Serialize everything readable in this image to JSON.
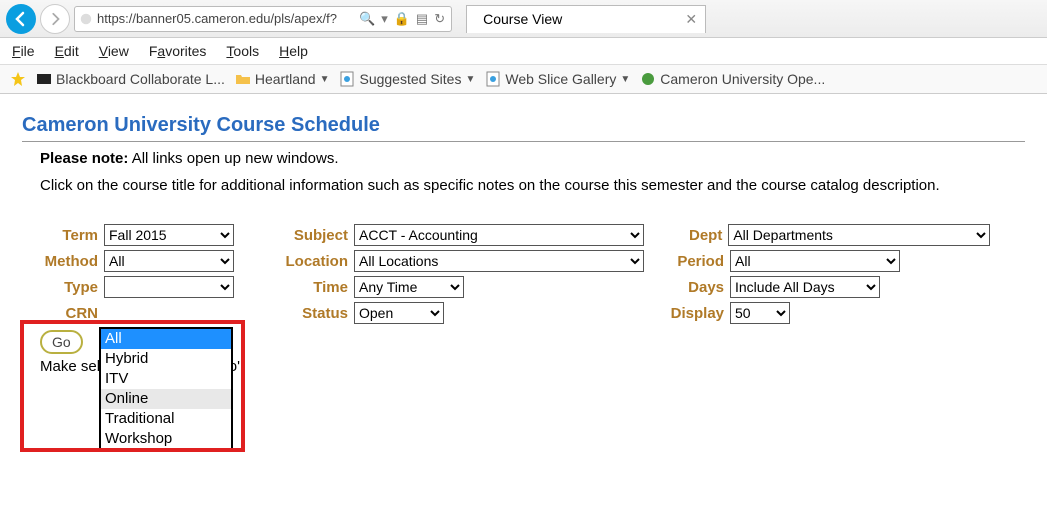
{
  "browser": {
    "url": "https://banner05.cameron.edu/pls/apex/f?",
    "tab_title": "Course View",
    "menus": [
      "File",
      "Edit",
      "View",
      "Favorites",
      "Tools",
      "Help"
    ],
    "bookmarks": [
      {
        "label": "Blackboard Collaborate L..."
      },
      {
        "label": "Heartland",
        "dropdown": true
      },
      {
        "label": "Suggested Sites",
        "dropdown": true
      },
      {
        "label": "Web Slice Gallery",
        "dropdown": true
      },
      {
        "label": "Cameron University Ope..."
      }
    ]
  },
  "page": {
    "title": "Cameron University Course Schedule",
    "note_label": "Please note:",
    "note_text": " All links open up new windows.",
    "subtext": "Click on the course title for additional information such as specific notes on the course this semester and the course catalog description.",
    "instructions": "Make selections and click 'Go'."
  },
  "filters": {
    "term": {
      "label": "Term",
      "value": "Fall 2015"
    },
    "subject": {
      "label": "Subject",
      "value": "ACCT - Accounting"
    },
    "dept": {
      "label": "Dept",
      "value": "All Departments"
    },
    "method": {
      "label": "Method",
      "value": "All",
      "options": [
        "All",
        "Hybrid",
        "ITV",
        "Online",
        "Traditional",
        "Workshop"
      ]
    },
    "location": {
      "label": "Location",
      "value": "All Locations"
    },
    "period": {
      "label": "Period",
      "value": "All"
    },
    "type": {
      "label": "Type",
      "value": ""
    },
    "time": {
      "label": "Time",
      "value": "Any Time"
    },
    "days": {
      "label": "Days",
      "value": "Include All Days"
    },
    "crn": {
      "label": "CRN",
      "value": ""
    },
    "status": {
      "label": "Status",
      "value": "Open"
    },
    "display": {
      "label": "Display",
      "value": "50"
    }
  },
  "buttons": {
    "go": "Go"
  }
}
